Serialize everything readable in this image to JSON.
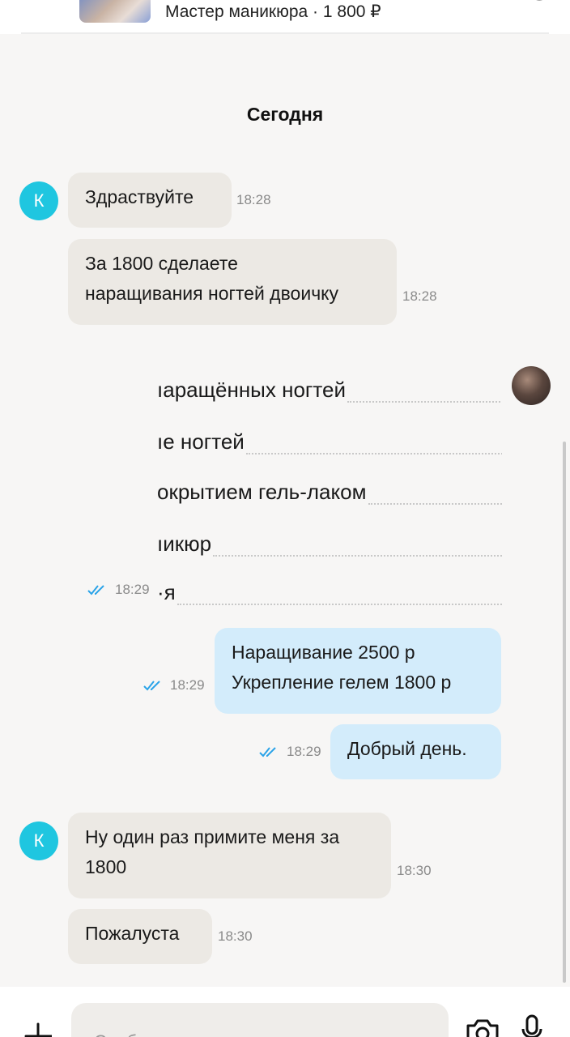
{
  "header": {
    "subtitle": "Мастер маникюра · 1 800 ₽"
  },
  "chat": {
    "date_divider": "Сегодня",
    "contact_initial": "К",
    "messages": [
      {
        "text": "Здраствуйте",
        "time": "18:28"
      },
      {
        "text_lines": [
          "За 1800 сделаете",
          "наращивания ногтей двоичку"
        ],
        "time": "18:28"
      },
      {
        "text_lines": [
          "Наращивание 2500 р",
          "Укрепление гелем 1800 р"
        ],
        "time": "18:29"
      },
      {
        "text": "Добрый день.",
        "time": "18:29"
      },
      {
        "text_lines": [
          "Ну один раз примите меня за",
          "1800"
        ],
        "time": "18:30"
      },
      {
        "text": "Пожалуста",
        "time": "18:30"
      }
    ],
    "price_list_image": {
      "lines": [
        "аращённых ногтей",
        "е ногтей",
        "окрытием гель-лаком",
        "икюр",
        "я"
      ],
      "time": "18:29"
    }
  },
  "composer": {
    "placeholder": "Сообщение"
  },
  "colors": {
    "incoming_bubble": "#ece9e4",
    "outgoing_bubble": "#d3ecfb",
    "avatar_accent": "#1fc6e0",
    "read_checks": "#2aa3e8"
  },
  "icons": [
    "back-arrow-icon",
    "phone-icon",
    "double-check-icon",
    "plus-icon",
    "camera-icon",
    "microphone-icon"
  ]
}
